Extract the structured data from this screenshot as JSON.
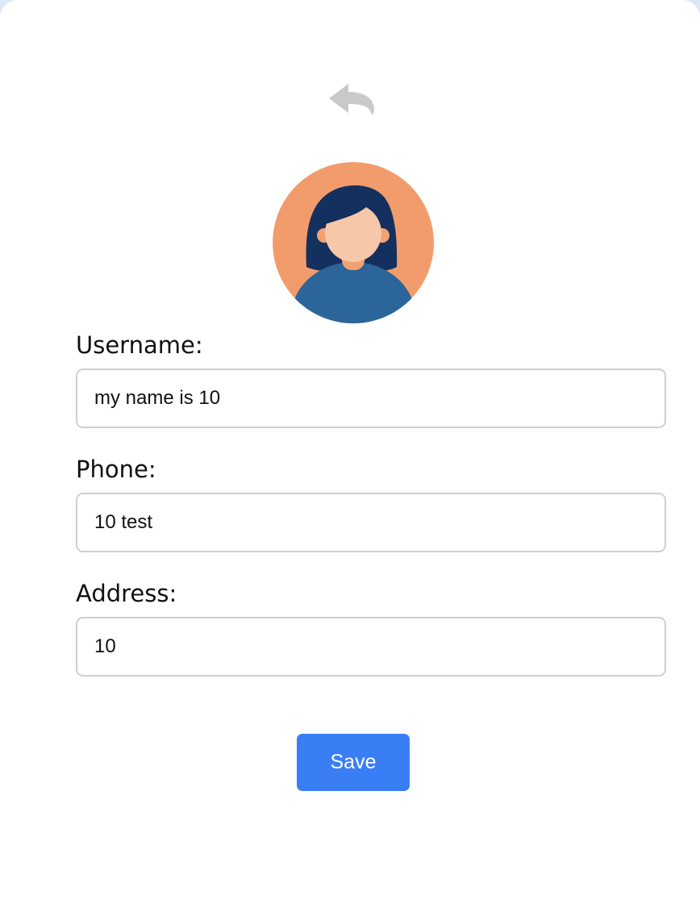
{
  "header": {
    "back_icon": "reply-arrow-icon"
  },
  "avatar": {
    "icon": "female-user-avatar",
    "colors": {
      "background": "#f29c6c",
      "hair": "#13305f",
      "skin": "#f7c7a9",
      "ear": "#f2a173",
      "shirt": "#2b6599"
    }
  },
  "form": {
    "fields": [
      {
        "label": "Username:",
        "value": "my name is 10"
      },
      {
        "label": "Phone:",
        "value": "10 test"
      },
      {
        "label": "Address:",
        "value": "10"
      }
    ],
    "save_label": "Save"
  },
  "colors": {
    "accent": "#3a7ef6",
    "icon_gray": "#c9c9c9",
    "input_border": "#cfcfcf"
  }
}
